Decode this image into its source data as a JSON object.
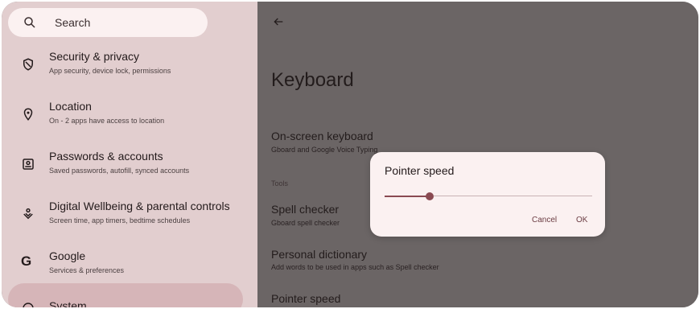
{
  "sidebar": {
    "search_placeholder": "Search",
    "items": [
      {
        "title": "Security & privacy",
        "subtitle": "App security, device lock, permissions",
        "icon": "shield-icon"
      },
      {
        "title": "Location",
        "subtitle": "On - 2 apps have access to location",
        "icon": "location-pin-icon"
      },
      {
        "title": "Passwords & accounts",
        "subtitle": "Saved passwords, autofill, synced accounts",
        "icon": "account-box-icon"
      },
      {
        "title": "Digital Wellbeing & parental controls",
        "subtitle": "Screen time, app timers, bedtime schedules",
        "icon": "wellbeing-icon"
      },
      {
        "title": "Google",
        "subtitle": "Services & preferences",
        "icon": "google-icon"
      },
      {
        "title": "System",
        "subtitle": "",
        "icon": "info-icon"
      }
    ]
  },
  "main": {
    "title": "Keyboard",
    "rows": [
      {
        "title": "On-screen keyboard",
        "subtitle": "Gboard and Google Voice Typing"
      },
      {
        "title": "Spell checker",
        "subtitle": "Gboard spell checker"
      },
      {
        "title": "Personal dictionary",
        "subtitle": "Add words to be used in apps such as Spell checker"
      },
      {
        "title": "Pointer speed",
        "subtitle": ""
      }
    ],
    "section_label": "Tools"
  },
  "dialog": {
    "title": "Pointer speed",
    "slider_value_fraction": 0.2,
    "cancel_label": "Cancel",
    "ok_label": "OK"
  },
  "colors": {
    "accent": "#8a4a52",
    "sidebar_bg": "#e2cecf",
    "scrim": "#6b6565",
    "selected": "#d6b5b8"
  }
}
